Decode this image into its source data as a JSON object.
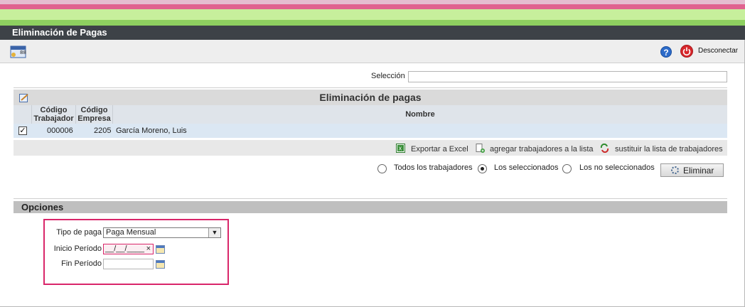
{
  "window": {
    "title": "Eliminación de Pagas"
  },
  "toolbar": {
    "help_icon": "help-icon",
    "power_icon": "power-icon",
    "disconnect_label": "Desconectar"
  },
  "selection": {
    "label": "Selección",
    "value": ""
  },
  "grid": {
    "title": "Eliminación de pagas",
    "columns": [
      {
        "line1": "Código",
        "line2": "Trabajador"
      },
      {
        "line1": "Código",
        "line2": "Empresa"
      },
      {
        "line1": "Nombre",
        "line2": ""
      }
    ],
    "rows": [
      {
        "checked": true,
        "codigo_trabajador": "000006",
        "codigo_empresa": "2205",
        "nombre": "García Moreno, Luis"
      }
    ]
  },
  "actions": {
    "export_excel": "Exportar a Excel",
    "add_workers": "agregar trabajadores a la lista",
    "replace_list": "sustituir la lista de trabajadores"
  },
  "filter": {
    "options": [
      "Todos los trabajadores",
      "Los seleccionados",
      "Los no seleccionados"
    ],
    "selected": "Los seleccionados",
    "delete_button": "Eliminar"
  },
  "options_section": {
    "title": "Opciones",
    "tipo_paga_label": "Tipo de paga",
    "tipo_paga_value": "Paga Mensual",
    "inicio_label": "Inicio Período",
    "inicio_value": "__/__/____",
    "fin_label": "Fin Período",
    "fin_value": ""
  },
  "colors": {
    "accent_pink": "#d9266a",
    "titlebar": "#3d4247",
    "row_selected": "#dbe7f3"
  }
}
